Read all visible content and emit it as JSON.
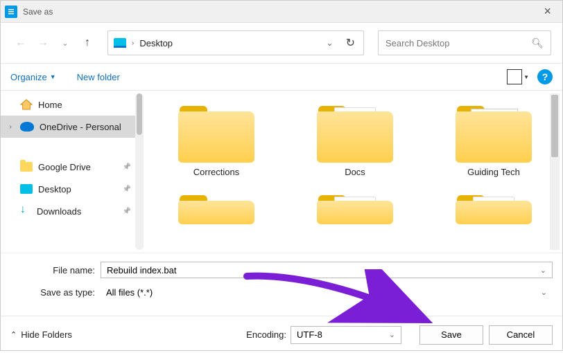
{
  "title": "Save as",
  "path": {
    "crumb": "Desktop"
  },
  "search": {
    "placeholder": "Search Desktop"
  },
  "toolbar": {
    "organize": "Organize",
    "newfolder": "New folder"
  },
  "sidebar": {
    "items": [
      {
        "label": "Home"
      },
      {
        "label": "OneDrive - Personal"
      },
      {
        "label": "Google Drive"
      },
      {
        "label": "Desktop"
      },
      {
        "label": "Downloads"
      }
    ]
  },
  "files": {
    "row1": [
      {
        "label": "Corrections"
      },
      {
        "label": "Docs"
      },
      {
        "label": "Guiding Tech"
      }
    ]
  },
  "form": {
    "filename_label": "File name:",
    "filename_value": "Rebuild index.bat",
    "type_label": "Save as type:",
    "type_value": "All files  (*.*)"
  },
  "footer": {
    "hide": "Hide Folders",
    "encoding_label": "Encoding:",
    "encoding_value": "UTF-8",
    "save": "Save",
    "cancel": "Cancel"
  }
}
